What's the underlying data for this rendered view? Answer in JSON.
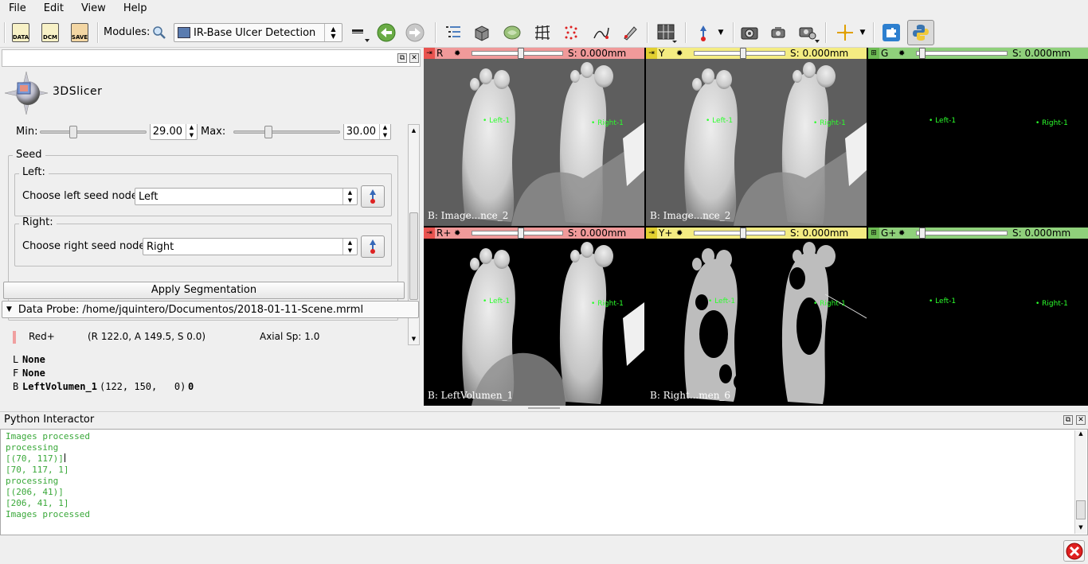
{
  "menu": {
    "file": "File",
    "edit": "Edit",
    "view": "View",
    "help": "Help"
  },
  "toolbar": {
    "data_label": "DATA",
    "dcm_label": "DCM",
    "save_label": "SAVE",
    "modules_label": "Modules:",
    "module_selected": "IR-Base Ulcer Detection"
  },
  "module_panel": {
    "logo_text": "3DSlicer",
    "min_label": "Min:",
    "min_value": "29.00",
    "max_label": "Max:",
    "max_value": "30.00",
    "seed_group": "Seed",
    "left_group": "Left:",
    "left_seed_label": "Choose left seed node:",
    "left_seed_value": "Left",
    "right_group": "Right:",
    "right_seed_label": "Choose right seed node:",
    "right_seed_value": "Right",
    "apply_button": "Apply Segmentation"
  },
  "data_probe": {
    "header": "Data Probe: /home/jquintero/Documentos/2018-01-11-Scene.mrml",
    "view_name": "Red+",
    "coords": "(R 122.0, A 149.5, S 0.0)",
    "spacing": "Axial Sp: 1.0",
    "layers": [
      {
        "key": "L",
        "name": "None",
        "ijk": "",
        "value": ""
      },
      {
        "key": "F",
        "name": "None",
        "ijk": "",
        "value": ""
      },
      {
        "key": "B",
        "name": "LeftVolumen_1",
        "ijk": "(122, 150,   0)",
        "value": "0"
      }
    ]
  },
  "views": [
    {
      "name": "R",
      "offset": "S: 0.000mm",
      "bg_label": "B: Image...nce_2",
      "fid_left": "Left-1",
      "fid_right": "Right-1"
    },
    {
      "name": "Y",
      "offset": "S: 0.000mm",
      "bg_label": "B: Image...nce_2",
      "fid_left": "Left-1",
      "fid_right": "Right-1"
    },
    {
      "name": "G",
      "offset": "S: 0.000mm",
      "bg_label": "",
      "fid_left": "Left-1",
      "fid_right": "Right-1"
    },
    {
      "name": "R+",
      "offset": "S: 0.000mm",
      "bg_label": "B: LeftVolumen_1",
      "fid_left": "Left-1",
      "fid_right": "Right-1"
    },
    {
      "name": "Y+",
      "offset": "S: 0.000mm",
      "bg_label": "B: Right...men_6",
      "fid_left": "Left-1",
      "fid_right": "Right-1"
    },
    {
      "name": "G+",
      "offset": "S: 0.000mm",
      "bg_label": "",
      "fid_left": "Left-1",
      "fid_right": "Right-1"
    }
  ],
  "view_colors": {
    "red": "#f09a9a",
    "red_accent": "#e9534f",
    "yellow": "#f4ec82",
    "yellow_accent": "#e1cf30",
    "green": "#8fd07b",
    "green_accent": "#6dbb53",
    "fiducial": "#2cff2c"
  },
  "python": {
    "title": "Python Interactor",
    "lines": [
      "Images processed",
      "processing",
      "[(70, 117)]",
      "[70, 117, 1]",
      "processing",
      "[(206, 41)]",
      "[206, 41, 1]",
      "Images processed"
    ],
    "text_color": "#39a839"
  }
}
